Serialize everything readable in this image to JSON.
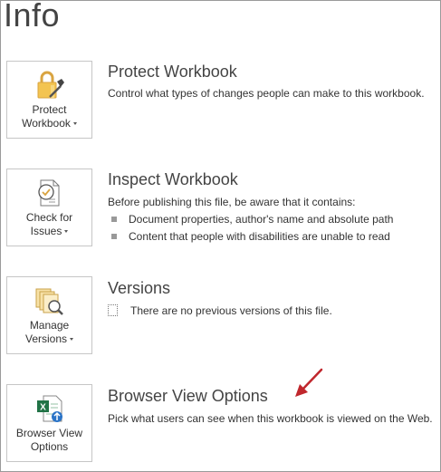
{
  "page": {
    "title": "Info"
  },
  "sections": [
    {
      "id": "protect",
      "button": {
        "line1": "Protect",
        "line2": "Workbook",
        "has_dropdown": true,
        "icon": "lock-key-icon"
      },
      "title": "Protect Workbook",
      "description": "Control what types of changes people can make to this workbook."
    },
    {
      "id": "inspect",
      "button": {
        "line1": "Check for",
        "line2": "Issues",
        "has_dropdown": true,
        "icon": "inspect-document-icon"
      },
      "title": "Inspect Workbook",
      "description": "Before publishing this file, be aware that it contains:",
      "bullets": [
        "Document properties, author's name and absolute path",
        "Content that people with disabilities are unable to read"
      ]
    },
    {
      "id": "versions",
      "button": {
        "line1": "Manage",
        "line2": "Versions",
        "has_dropdown": true,
        "icon": "versions-magnifier-icon"
      },
      "title": "Versions",
      "note": "There are no previous versions of this file."
    },
    {
      "id": "browser",
      "button": {
        "line1": "Browser View",
        "line2": "Options",
        "has_dropdown": false,
        "icon": "excel-web-icon"
      },
      "title": "Browser View Options",
      "description": "Pick what users can see when this workbook is viewed on the Web."
    }
  ],
  "annotation": {
    "icon": "red-arrow-icon",
    "color": "#c0272d"
  }
}
